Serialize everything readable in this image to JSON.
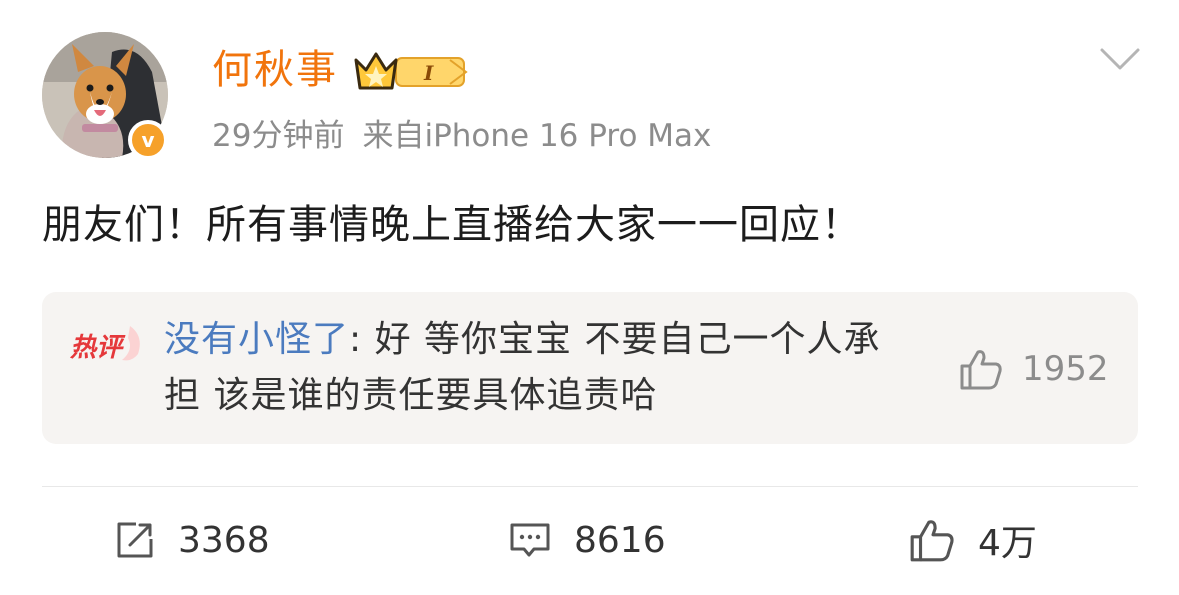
{
  "post": {
    "user": {
      "name": "何秋事",
      "avatar_icon": "corgi-avatar",
      "verified_icon": "verified-v-icon",
      "verified_mark": "v",
      "badge_icon": "crown-level-badge-icon",
      "badge_level": "I"
    },
    "meta": {
      "time": "29分钟前",
      "source": "来自iPhone 16 Pro Max"
    },
    "more_icon": "chevron-down-icon",
    "content": "朋友们！所有事情晚上直播给大家一一回应！",
    "hot_comment": {
      "tag_label": "热评",
      "user": "没有小怪了",
      "separator": ": ",
      "text": "好 等你宝宝 不要自己一个人承担 该是谁的责任要具体追责哈",
      "like_icon": "thumbs-up-icon",
      "like_count": "1952"
    },
    "actions": {
      "repost": {
        "icon": "repost-icon",
        "count": "3368"
      },
      "comment": {
        "icon": "comment-icon",
        "count": "8616"
      },
      "like": {
        "icon": "thumbs-up-icon",
        "count": "4万"
      }
    },
    "colors": {
      "username": "#f1740c",
      "meta": "#8c8c8c",
      "hot_user": "#4b7bbf",
      "hot_bg": "#f6f4f2",
      "hot_tag": "#e5383b",
      "verified": "#f6a12a"
    }
  }
}
